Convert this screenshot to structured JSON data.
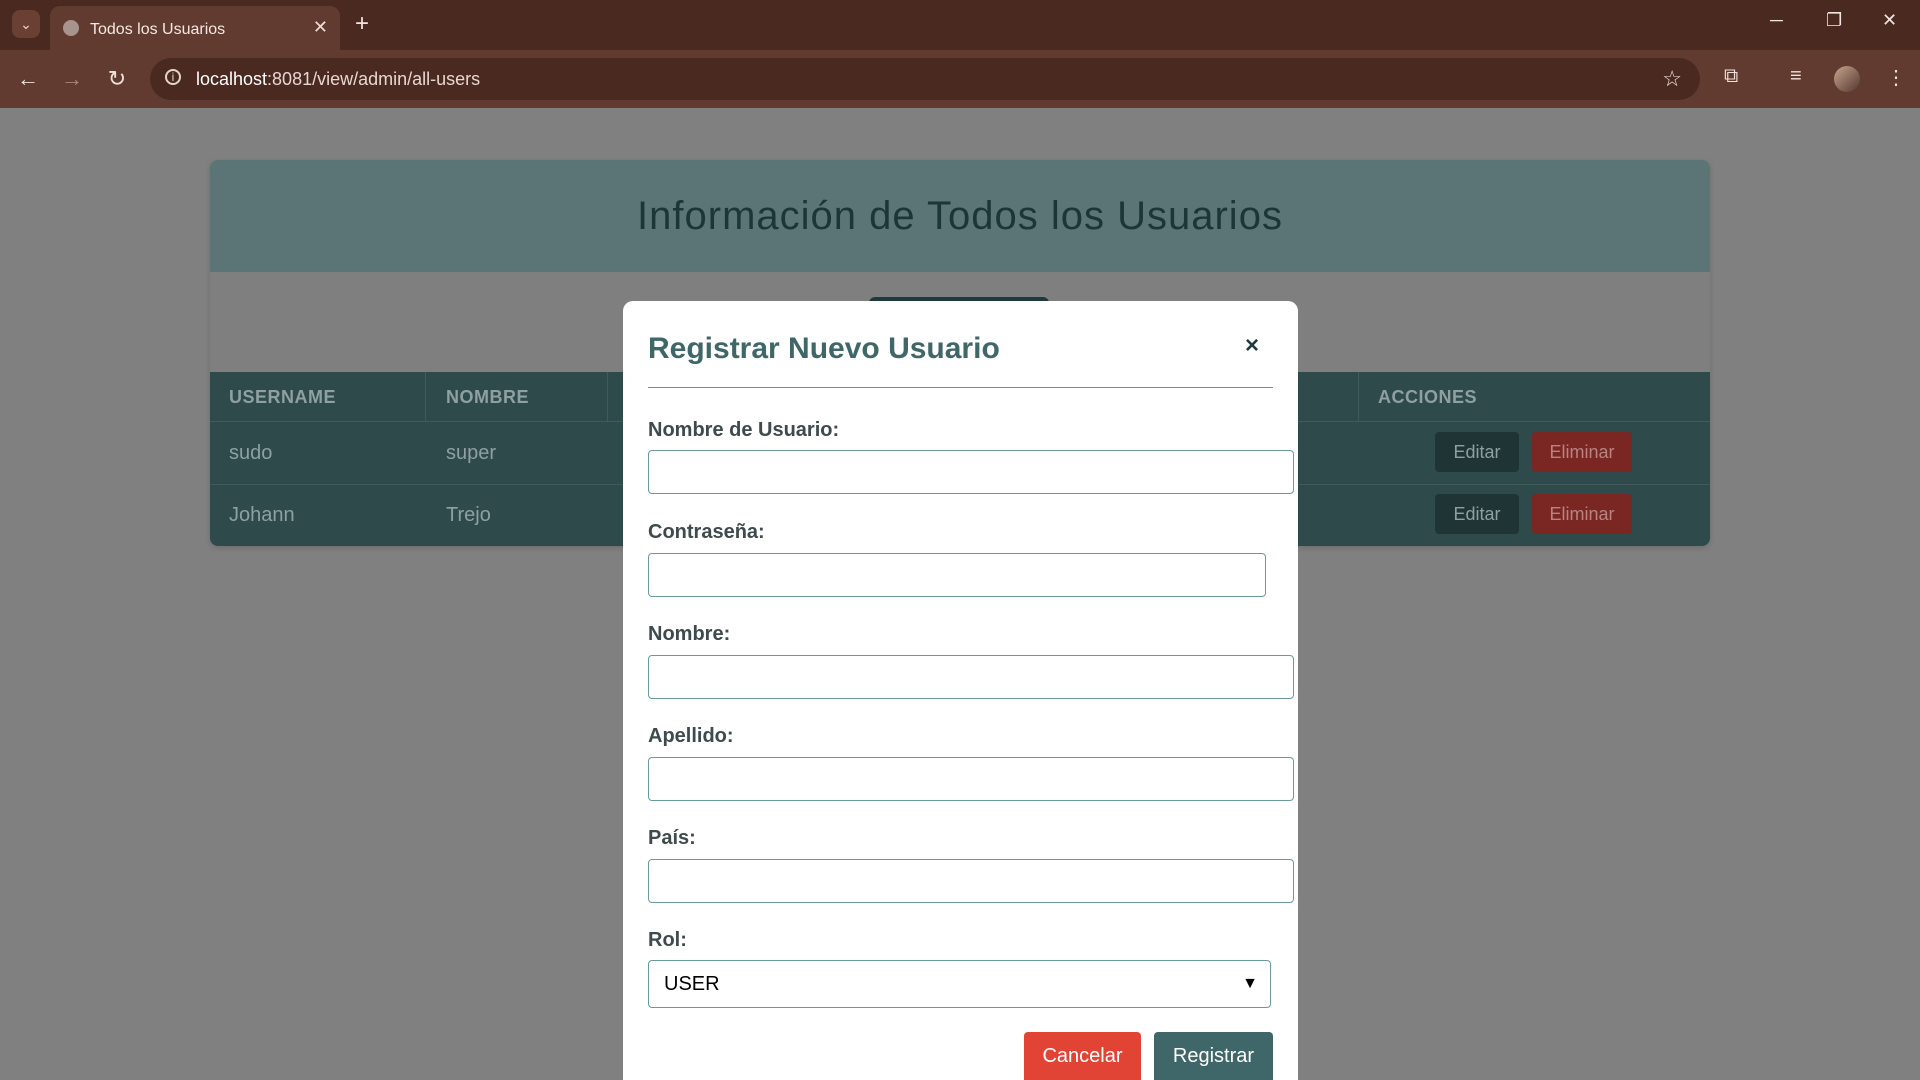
{
  "browser": {
    "tab_title": "Todos los Usuarios",
    "url_host": "localhost",
    "url_rest": ":8081/view/admin/all-users"
  },
  "page": {
    "title": "Información de Todos los Usuarios",
    "table": {
      "headers": [
        "USERNAME",
        "NOMBRE",
        "ACCIONES"
      ],
      "rows": [
        {
          "username": "sudo",
          "nombre": "super"
        },
        {
          "username": "Johann",
          "nombre": "Trejo"
        }
      ],
      "edit_label": "Editar",
      "delete_label": "Eliminar"
    }
  },
  "modal": {
    "title": "Registrar Nuevo Usuario",
    "close": "×",
    "fields": {
      "username_label": "Nombre de Usuario:",
      "password_label": "Contraseña:",
      "name_label": "Nombre:",
      "lastname_label": "Apellido:",
      "country_label": "País:",
      "role_label": "Rol:",
      "role_value": "USER"
    },
    "cancel_label": "Cancelar",
    "register_label": "Registrar"
  }
}
